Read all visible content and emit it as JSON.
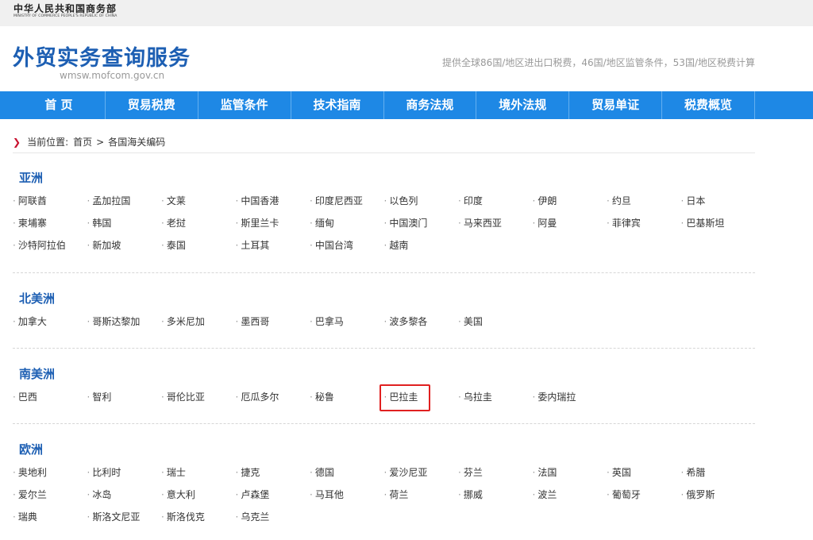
{
  "ministry": {
    "name_cn": "中华人民共和国商务部",
    "name_en": "MINISTRY OF COMMERCE PEOPLE'S REPUBLIC OF CHINA"
  },
  "header": {
    "title": "外贸实务查询服务",
    "url": "wmsw.mofcom.gov.cn",
    "slogan": "提供全球86国/地区进出口税费，46国/地区监管条件，53国/地区税费计算"
  },
  "nav": {
    "items": [
      "首 页",
      "贸易税费",
      "监管条件",
      "技术指南",
      "商务法规",
      "境外法规",
      "贸易单证",
      "税费概览"
    ]
  },
  "breadcrumb": {
    "prefix": "当前位置:",
    "home": "首页",
    "separator": ">",
    "current": "各国海关编码"
  },
  "regions": [
    {
      "name": "亚洲",
      "countries": [
        "阿联酋",
        "孟加拉国",
        "文莱",
        "中国香港",
        "印度尼西亚",
        "以色列",
        "印度",
        "伊朗",
        "约旦",
        "日本",
        "柬埔寨",
        "韩国",
        "老挝",
        "斯里兰卡",
        "缅甸",
        "中国澳门",
        "马来西亚",
        "阿曼",
        "菲律宾",
        "巴基斯坦",
        "沙特阿拉伯",
        "新加坡",
        "泰国",
        "土耳其",
        "中国台湾",
        "越南"
      ]
    },
    {
      "name": "北美洲",
      "countries": [
        "加拿大",
        "哥斯达黎加",
        "多米尼加",
        "墨西哥",
        "巴拿马",
        "波多黎各",
        "美国"
      ]
    },
    {
      "name": "南美洲",
      "countries": [
        "巴西",
        "智利",
        "哥伦比亚",
        "厄瓜多尔",
        "秘鲁",
        "巴拉圭",
        "乌拉圭",
        "委内瑞拉"
      ],
      "highlighted": "巴拉圭"
    },
    {
      "name": "欧洲",
      "countries": [
        "奥地利",
        "比利时",
        "瑞士",
        "捷克",
        "德国",
        "爱沙尼亚",
        "芬兰",
        "法国",
        "英国",
        "希腊",
        "爱尔兰",
        "冰岛",
        "意大利",
        "卢森堡",
        "马耳他",
        "荷兰",
        "挪威",
        "波兰",
        "葡萄牙",
        "俄罗斯",
        "瑞典",
        "斯洛文尼亚",
        "斯洛伐克",
        "乌克兰"
      ]
    }
  ],
  "colors": {
    "brand_blue": "#1d5fb3",
    "nav_bg": "#1e88e5",
    "highlight_border": "#e02020",
    "breadcrumb_arrow": "#c8102e"
  }
}
